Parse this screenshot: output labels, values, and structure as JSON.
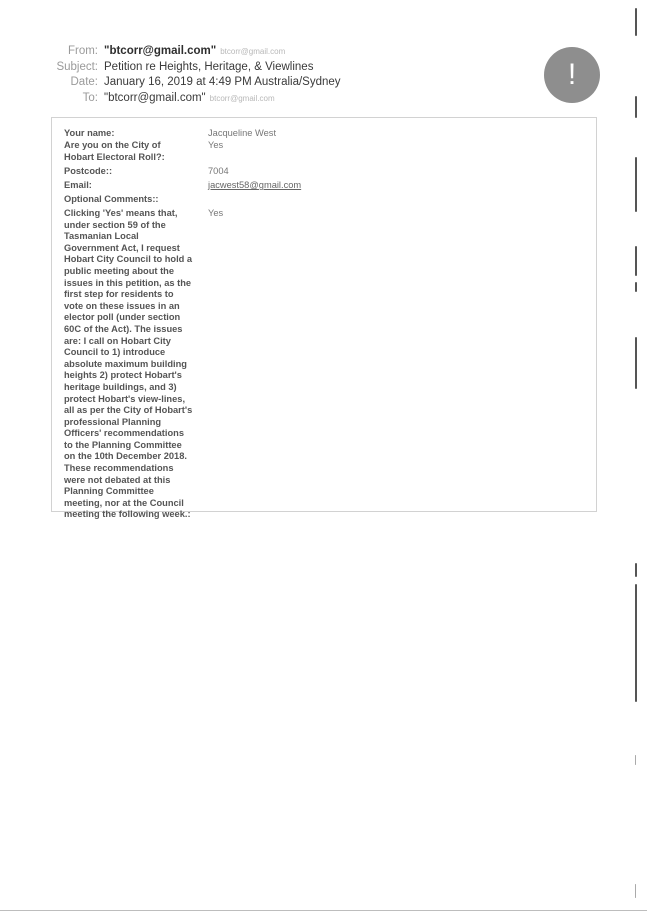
{
  "email": {
    "headers": [
      {
        "label": "From:",
        "value": "\"btcorr@gmail.com\"",
        "sub": "btcorr@gmail.com",
        "bold": true
      },
      {
        "label": "Subject:",
        "value": "Petition re Heights, Heritage, & Viewlines",
        "sub": "",
        "bold": false
      },
      {
        "label": "Date:",
        "value": "January 16, 2019 at 4:49 PM Australia/Sydney",
        "sub": "",
        "bold": false
      },
      {
        "label": "To:",
        "value": "\"btcorr@gmail.com\"",
        "sub": "btcorr@gmail.com",
        "bold": false
      }
    ],
    "priority_icon": "exclamation-icon",
    "priority_symbol": "!"
  },
  "form": {
    "rows": [
      {
        "label": "Your name:",
        "value": "Jacqueline West",
        "link": false
      },
      {
        "label": "Are you on the City of Hobart Electoral Roll?:",
        "value": "Yes",
        "link": false
      },
      {
        "label": "Postcode::",
        "value": "7004",
        "link": false
      },
      {
        "label": "Email:",
        "value": "jacwest58@gmail.com",
        "link": true
      },
      {
        "label": "Optional Comments::",
        "value": "",
        "link": false
      },
      {
        "label": "Clicking 'Yes' means that, under section 59 of the Tasmanian Local Government Act, I request Hobart City Council to hold a public meeting about the issues in this petition, as the first step for residents to vote on these issues in an elector poll (under section 60C of the Act). The issues are: I call on Hobart City Council to 1) introduce absolute maximum building heights 2) protect Hobart's heritage buildings, and 3) protect Hobart's view-lines, all as per the City of Hobart's professional Planning Officers' recommendations to the Planning Committee on the 10th December 2018. These recommendations were not debated at this Planning Committee meeting, nor at the Council meeting the following week.:",
        "value": "Yes",
        "link": false
      }
    ],
    "long_label_lines": [
      "Clicking 'Yes' means that,",
      "under section 59 of the",
      "Tasmanian Local",
      "Government Act, I request",
      "Hobart City Council to hold a",
      "public meeting about the",
      "issues in this petition, as the",
      "first step for residents to",
      "vote on these issues in an",
      "elector poll (under section",
      "60C of the Act). The issues",
      "are: I call on Hobart City",
      "Council to 1) introduce",
      "absolute maximum building",
      "heights 2) protect Hobart's",
      "heritage buildings, and 3)",
      "protect Hobart's view-lines,",
      "all as per the City of Hobart's",
      "professional Planning",
      "Officers' recommendations",
      "to the Planning Committee",
      "on the 10th December 2018.",
      "These recommendations",
      "were not debated at this",
      "Planning Committee",
      "meeting, nor at the Council",
      "meeting the following week.:"
    ],
    "roll_label_lines": [
      "Are you on the City of",
      "Hobart Electoral Roll?:"
    ]
  }
}
